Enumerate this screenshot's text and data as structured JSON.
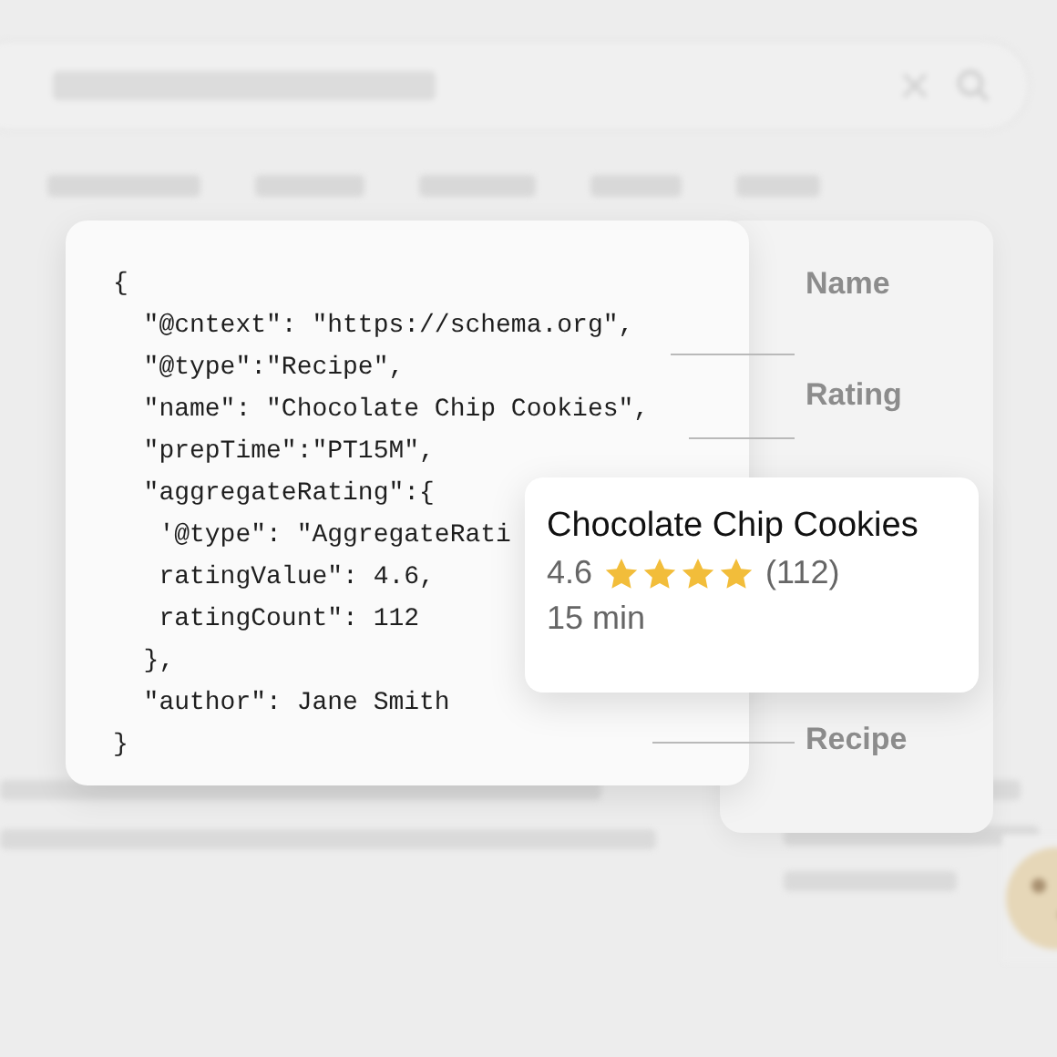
{
  "code_lines": [
    "{",
    "  \"@cntext\": \"https://schema.org\",",
    "  \"@type\":\"Recipe\",",
    "  \"name\": \"Chocolate Chip Cookies\",",
    "  \"prepTime\":\"PT15M\",",
    "  \"aggregateRating\":{",
    "   '@type\": \"AggregateRati",
    "   ratingValue\": 4.6,",
    "   ratingCount\": 112",
    "  },",
    "  \"author\": Jane Smith",
    "}"
  ],
  "annotations": [
    {
      "label": "Name"
    },
    {
      "label": "Rating"
    },
    {
      "label": "Recipe"
    }
  ],
  "result_card": {
    "title": "Chocolate Chip Cookies",
    "rating": "4.6",
    "stars": 4,
    "count": "(112)",
    "time": "15 min"
  }
}
